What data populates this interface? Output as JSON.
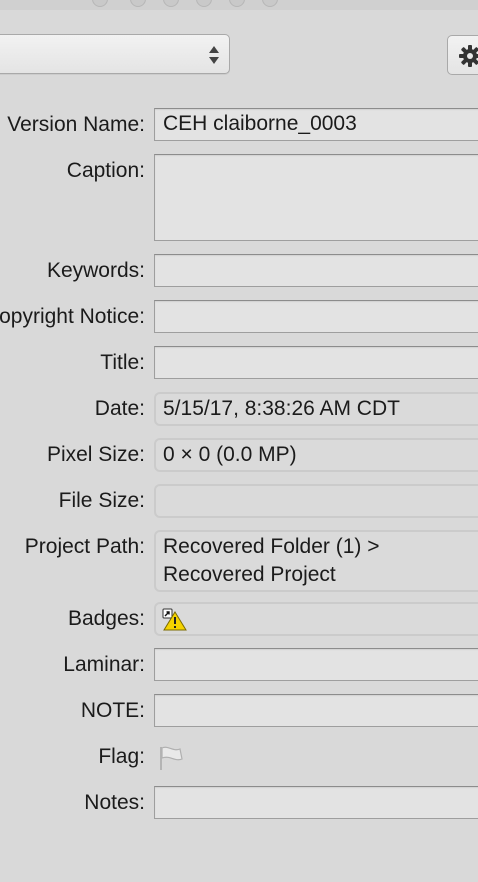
{
  "window": {
    "popup_value": ""
  },
  "toolbar": {
    "action_icon": "gear-icon"
  },
  "fields": [
    {
      "id": "version-name",
      "label": "Version Name:",
      "value": "CEH claiborne_0003",
      "editable": true
    },
    {
      "id": "caption",
      "label": "Caption:",
      "value": "",
      "editable": true
    },
    {
      "id": "keywords",
      "label": "Keywords:",
      "value": "",
      "editable": true
    },
    {
      "id": "copyright-notice",
      "label": "Copyright Notice:",
      "value": "",
      "editable": true
    },
    {
      "id": "title",
      "label": "Title:",
      "value": "",
      "editable": true
    },
    {
      "id": "date",
      "label": "Date:",
      "value": "5/15/17, 8:38:26 AM CDT",
      "editable": false
    },
    {
      "id": "pixel-size",
      "label": "Pixel Size:",
      "value": "0 × 0 (0.0 MP)",
      "editable": false
    },
    {
      "id": "file-size",
      "label": "File Size:",
      "value": "",
      "editable": false
    },
    {
      "id": "project-path",
      "label": "Project Path:",
      "value": "Recovered Folder (1) > Recovered Project",
      "editable": false
    },
    {
      "id": "badges",
      "label": "Badges:",
      "icons": [
        "alias-arrow-icon",
        "warning-icon"
      ],
      "editable": false
    },
    {
      "id": "laminar",
      "label": "Laminar:",
      "value": "",
      "editable": true
    },
    {
      "id": "note",
      "label": "NOTE:",
      "value": "",
      "editable": true
    },
    {
      "id": "flag",
      "label": "Flag:",
      "icon": "flag-icon",
      "editable": true
    },
    {
      "id": "notes",
      "label": "Notes:",
      "value": "",
      "editable": true
    }
  ],
  "colors": {
    "warning": "#f5d300",
    "panel": "#d9d9d9",
    "field": "#e3e3e3"
  }
}
